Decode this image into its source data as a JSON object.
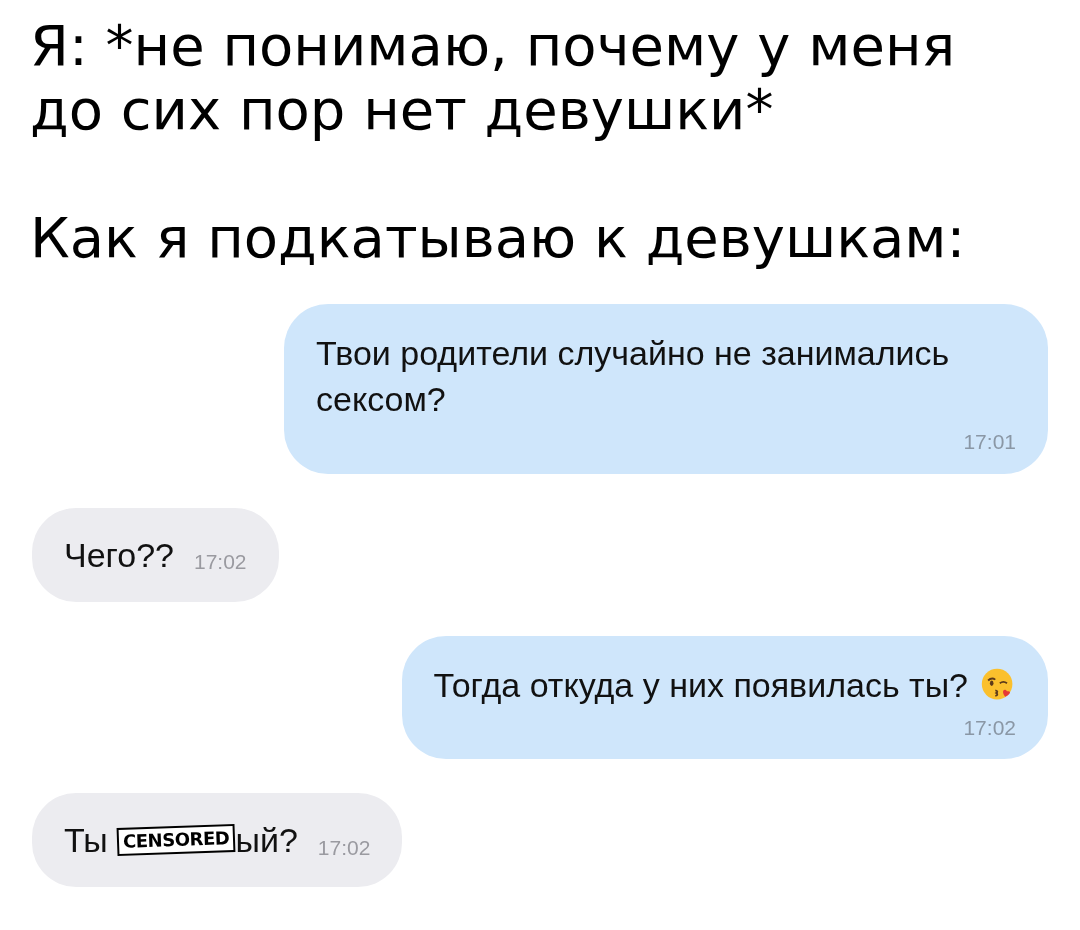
{
  "caption": {
    "lines": [
      "Я: *не понимаю, почему у меня до сих пор нет девушки*",
      "Как я подкатываю к девушкам:"
    ]
  },
  "messages": [
    {
      "kind": "outgoing",
      "text": "Твои родители случайно не занимались сексом?",
      "time": "17:01"
    },
    {
      "kind": "incoming",
      "text": "Чего??",
      "time": "17:02"
    },
    {
      "kind": "outgoing",
      "text": "Тогда откуда у них появилась ты?",
      "time": "17:02",
      "emoji": true
    },
    {
      "kind": "incoming",
      "text": "Ты ",
      "censor": "CENSORED",
      "text_after": "ый?",
      "time": "17:02"
    }
  ]
}
